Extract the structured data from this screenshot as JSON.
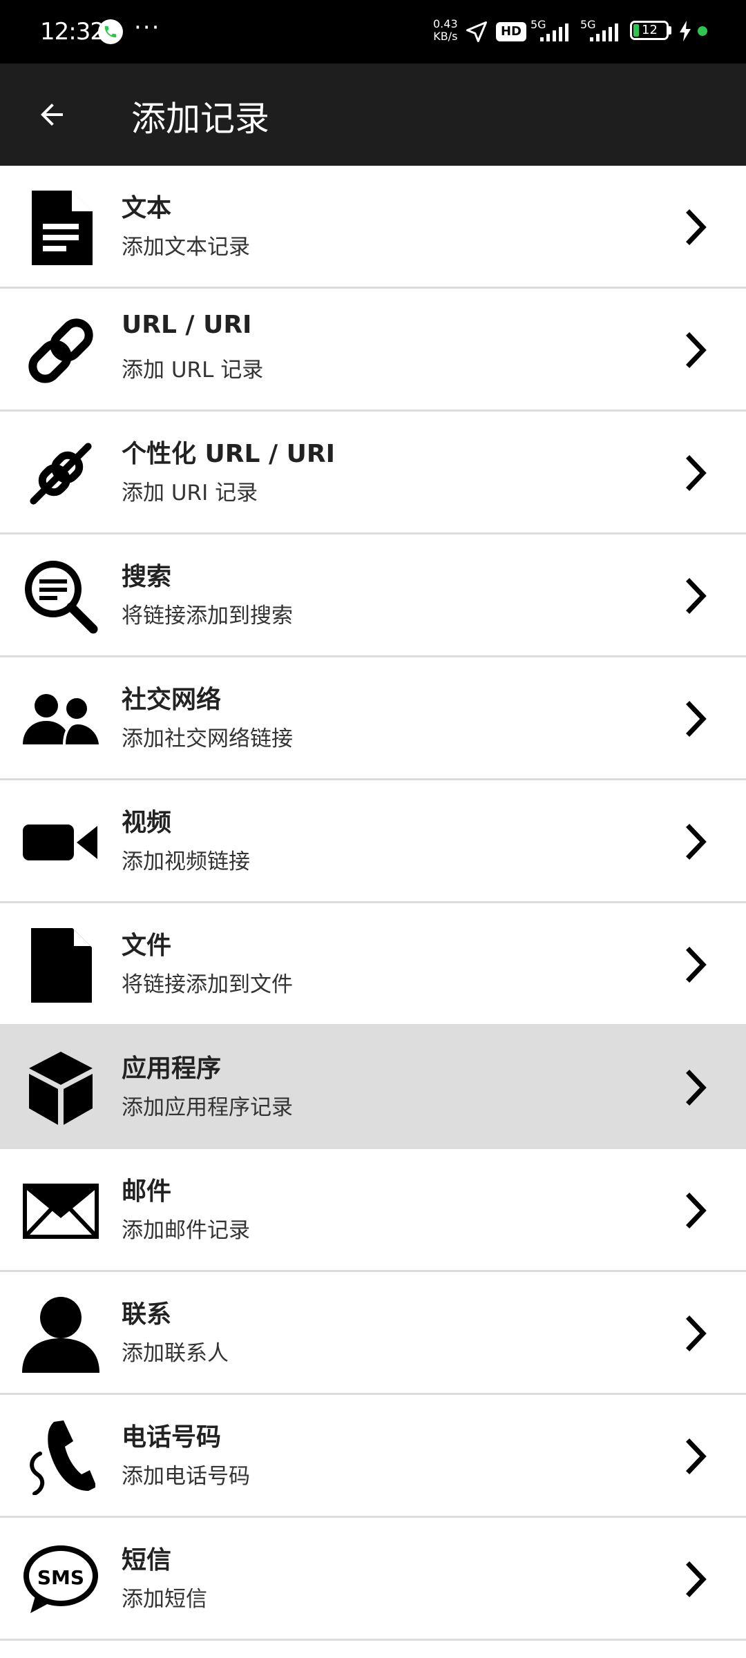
{
  "status_bar": {
    "time": "12:32",
    "more": "···",
    "net_speed_value": "0.43",
    "net_speed_unit": "KB/s",
    "hd_badge": "HD",
    "signal1_label": "5G",
    "signal2_label": "5G",
    "battery_level": "12"
  },
  "app_bar": {
    "title": "添加记录",
    "back_icon": "arrow-left-icon"
  },
  "items": [
    {
      "title": "文本",
      "subtitle": "添加文本记录",
      "icon": "text-document-icon"
    },
    {
      "title": "URL / URI",
      "subtitle": "添加 URL 记录",
      "icon": "link-icon"
    },
    {
      "title": "个性化 URL / URI",
      "subtitle": "添加 URI 记录",
      "icon": "custom-link-icon"
    },
    {
      "title": "搜索",
      "subtitle": "将链接添加到搜索",
      "icon": "search-icon"
    },
    {
      "title": "社交网络",
      "subtitle": "添加社交网络链接",
      "icon": "people-icon"
    },
    {
      "title": "视频",
      "subtitle": "添加视频链接",
      "icon": "video-camera-icon"
    },
    {
      "title": "文件",
      "subtitle": "将链接添加到文件",
      "icon": "file-icon"
    },
    {
      "title": "应用程序",
      "subtitle": "添加应用程序记录",
      "icon": "cube-icon",
      "selected": true
    },
    {
      "title": "邮件",
      "subtitle": "添加邮件记录",
      "icon": "envelope-icon"
    },
    {
      "title": "联系",
      "subtitle": "添加联系人",
      "icon": "person-icon"
    },
    {
      "title": "电话号码",
      "subtitle": "添加电话号码",
      "icon": "phone-icon"
    },
    {
      "title": "短信",
      "subtitle": "添加短信",
      "icon": "sms-bubble-icon",
      "icon_text": "SMS"
    }
  ],
  "colors": {
    "status_bar": "#000000",
    "app_bar": "#1e1e1e",
    "selected_row": "#dddddd",
    "divider": "#dcdcdc",
    "battery": "#2ec452"
  }
}
